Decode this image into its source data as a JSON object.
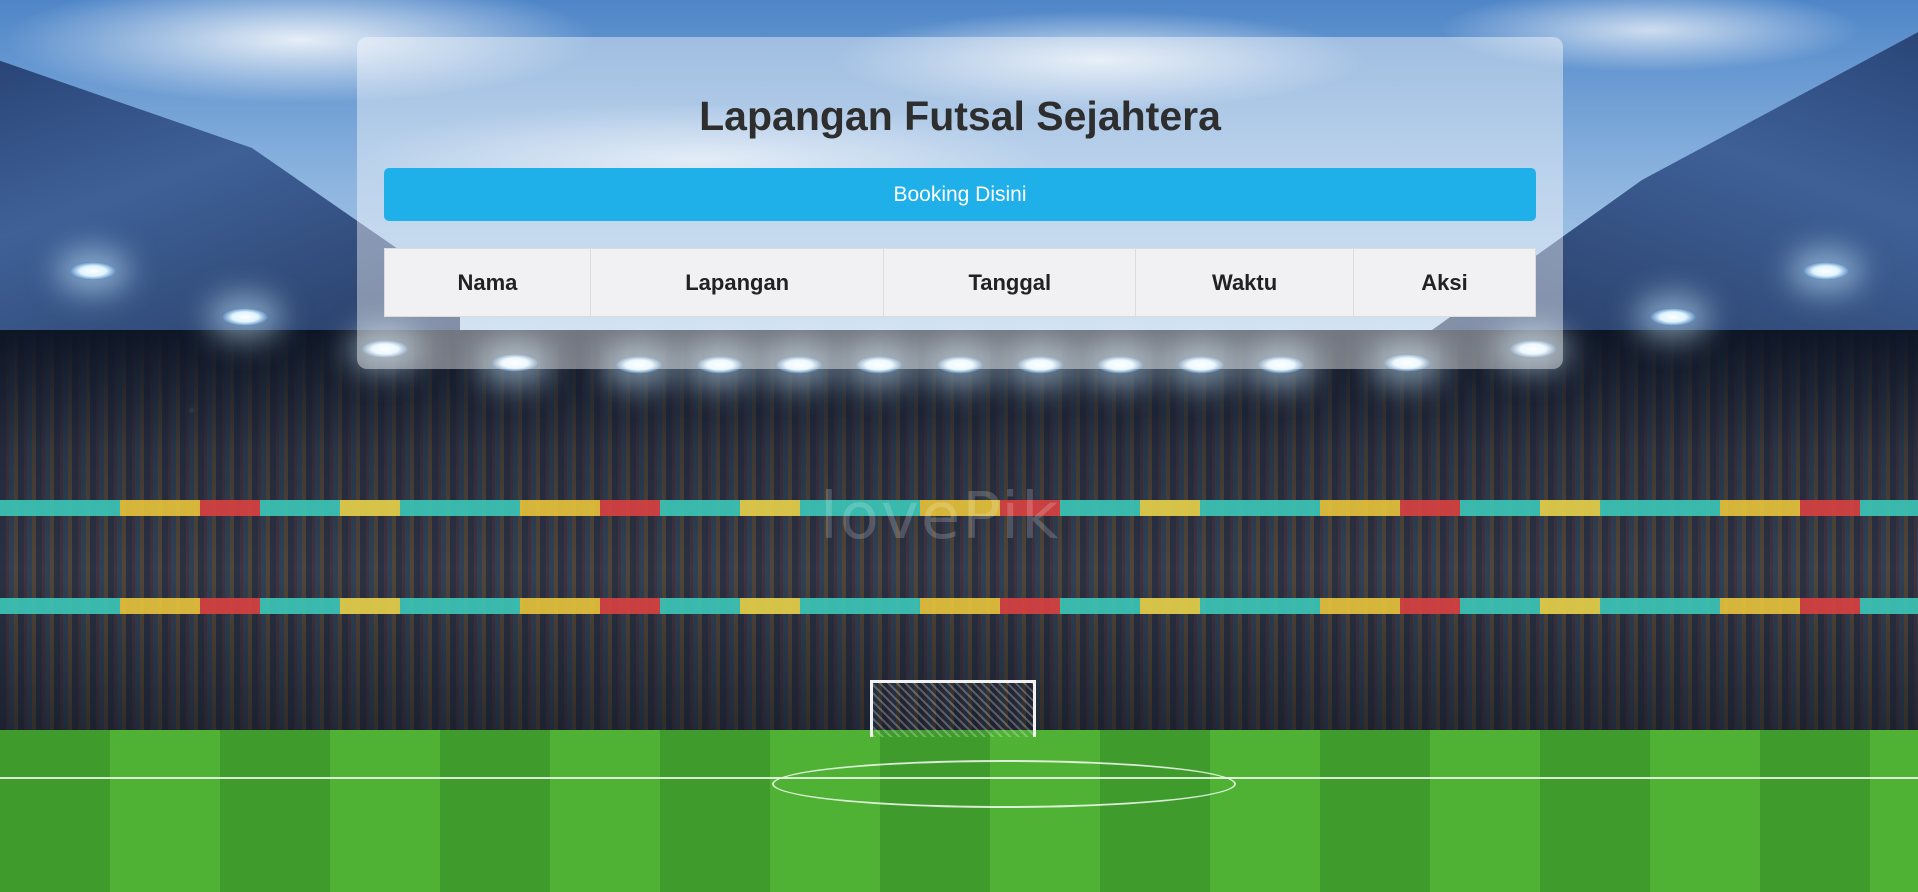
{
  "page": {
    "title": "Lapangan Futsal Sejahtera"
  },
  "booking_button": {
    "label": "Booking Disini",
    "color": "#1fb0ea"
  },
  "table": {
    "columns": [
      "Nama",
      "Lapangan",
      "Tanggal",
      "Waktu",
      "Aksi"
    ],
    "rows": []
  },
  "background": {
    "description_icon": "stadium-background",
    "watermark": "lovePik"
  }
}
